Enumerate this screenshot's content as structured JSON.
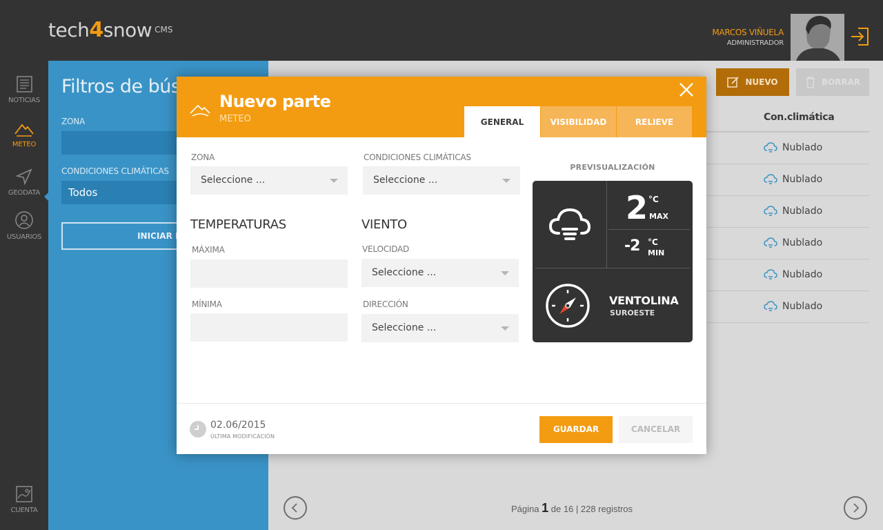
{
  "header": {
    "logo": {
      "part1": "tech",
      "part2": "4",
      "part3": "snow",
      "suffix": "CMS"
    },
    "user_name": "MARCOS VIÑUELA",
    "user_role": "ADMINISTRADOR"
  },
  "nav": {
    "items": [
      {
        "label": "NOTICIAS",
        "icon": "newspaper-icon"
      },
      {
        "label": "METEO",
        "icon": "mountain-icon",
        "active": true
      },
      {
        "label": "GEODATA",
        "icon": "navigation-arrow-icon"
      },
      {
        "label": "USUARIOS",
        "icon": "user-icon"
      }
    ],
    "bottom": {
      "label": "CUENTA",
      "icon": "map-icon"
    }
  },
  "filters": {
    "title": "Filtros de búsqueda",
    "zona_label": "ZONA",
    "zona_value": "",
    "condiciones_label": "CONDICIONES CLIMÁTICAS",
    "condiciones_value": "Todos",
    "search_button": "INICIAR BÚSQUEDA"
  },
  "list": {
    "new_button": "NUEVO",
    "delete_button": "BORRAR",
    "column_header": "Con.climática",
    "rows": [
      "Nublado",
      "Nublado",
      "Nublado",
      "Nublado",
      "Nublado",
      "Nublado"
    ],
    "pager": {
      "prefix": "Página",
      "current": "1",
      "middle": "de 16 | 228 registros"
    }
  },
  "modal": {
    "title": "Nuevo parte",
    "subtitle": "METEO",
    "tabs": [
      "GENERAL",
      "VISIBILIDAD",
      "RELIEVE"
    ],
    "active_tab": "GENERAL",
    "zona": {
      "label": "ZONA",
      "value": "Seleccione ..."
    },
    "condiciones": {
      "label": "CONDICIONES CLIMÁTICAS",
      "value": "Seleccione ..."
    },
    "temperaturas": {
      "title": "TEMPERATURAS",
      "max_label": "MÁXIMA",
      "min_label": "MÍNIMA",
      "max_value": "",
      "min_value": ""
    },
    "viento": {
      "title": "VIENTO",
      "velocidad_label": "VELOCIDAD",
      "velocidad_value": "Seleccione ...",
      "direccion_label": "DIRECCIÓN",
      "direccion_value": "Seleccione ..."
    },
    "preview": {
      "label": "PREVISUALIZACIÓN",
      "max_temp": "2",
      "max_unit": "°C",
      "max_tag": "MAX",
      "min_temp": "-2",
      "min_unit": "°C",
      "min_tag": "MIN",
      "wind_name": "VENTOLINA",
      "wind_dir": "SUROESTE"
    },
    "footer": {
      "date": "02.06/2015",
      "date_label": "ÚLTIMA MODIFICACIÓN",
      "save": "GUARDAR",
      "cancel": "CANCELAR"
    }
  },
  "colors": {
    "accent": "#f39c12",
    "panel": "#3a93c6",
    "dark": "#333333"
  }
}
